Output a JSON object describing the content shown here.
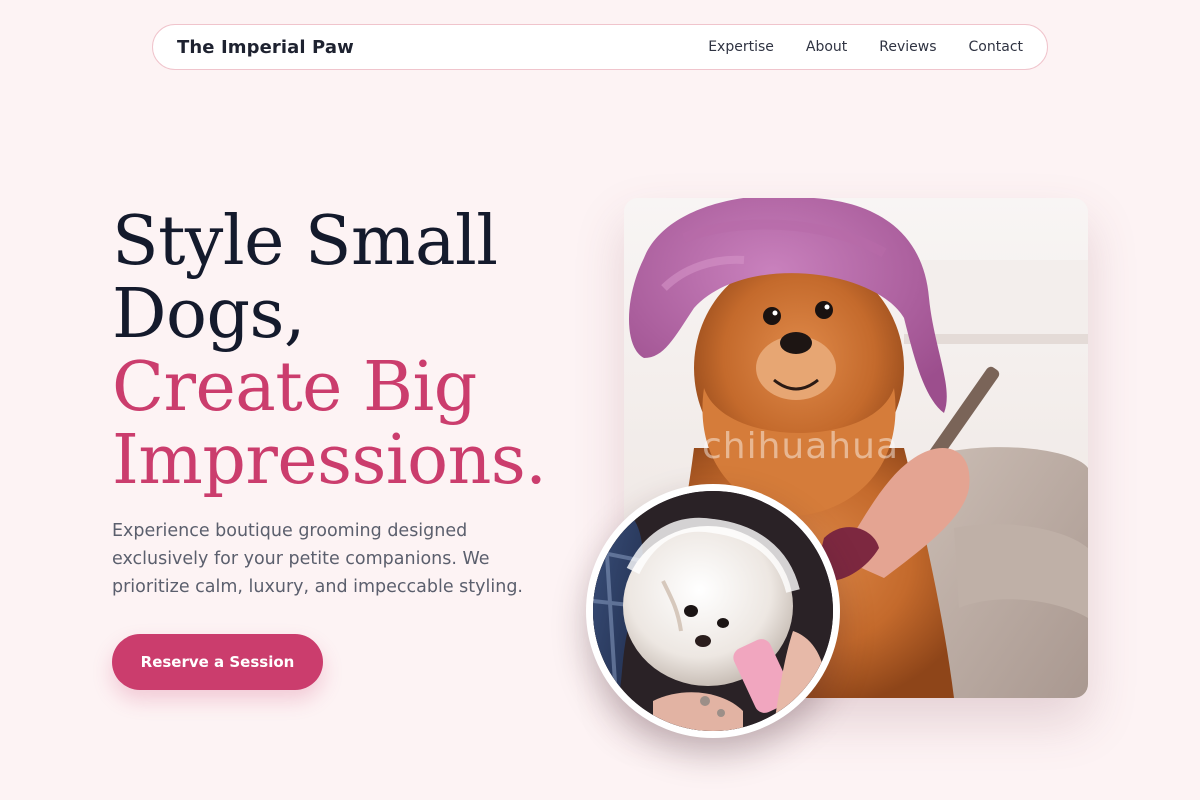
{
  "brand": "The Imperial Paw",
  "nav": {
    "links": [
      "Expertise",
      "About",
      "Reviews",
      "Contact"
    ]
  },
  "hero": {
    "title_line1": "Style Small",
    "title_line2": "Dogs,",
    "title_line3": "Create Big",
    "title_line4": "Impressions.",
    "subtitle": "Experience boutique grooming designed exclusively for your petite companions. We prioritize calm, luxury, and impeccable styling.",
    "cta_label": "Reserve a Session"
  },
  "media": {
    "main_photo_watermark": "chihuahua"
  },
  "colors": {
    "accent": "#cb3d6d",
    "background": "#fdf3f4",
    "heading": "#141a2c",
    "body_text": "#5b5f6d"
  }
}
